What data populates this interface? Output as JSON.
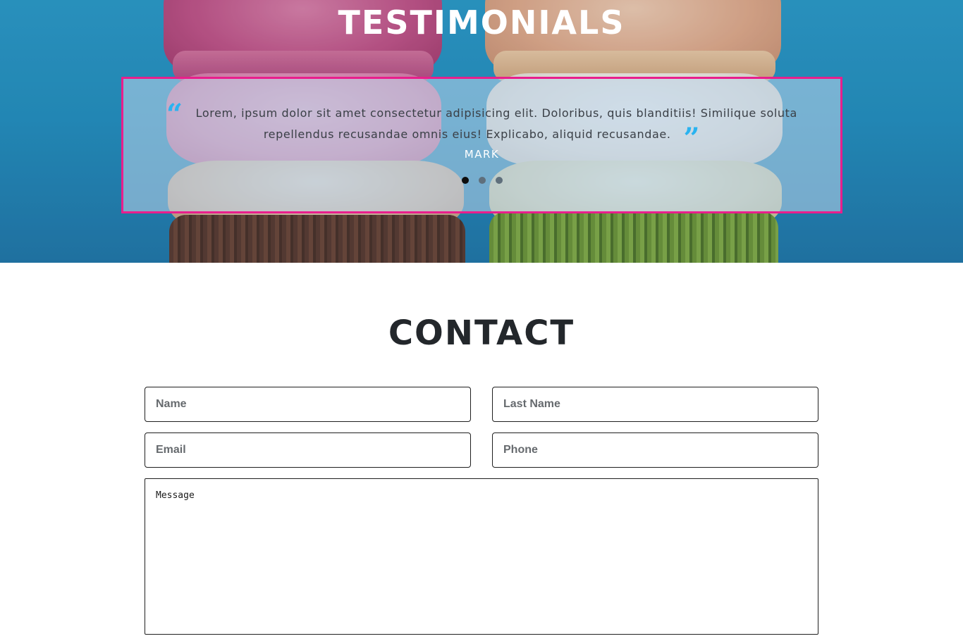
{
  "testimonials": {
    "title": "TESTIMONIALS",
    "quote_text": "Lorem, ipsum dolor sit amet consectetur adipisicing elit. Doloribus, quis blanditiis! Similique soluta repellendus recusandae omnis eius! Explicabo, aliquid recusandae.",
    "author": "MARK",
    "quote_open_icon": "quote-open-icon",
    "quote_close_icon": "quote-close-icon",
    "slides": [
      {
        "active": true
      },
      {
        "active": false
      },
      {
        "active": false
      }
    ],
    "colors": {
      "border": "#e91e8c",
      "quote_icon": "#2ab3f0",
      "title": "#ffffff"
    }
  },
  "contact": {
    "title": "CONTACT",
    "fields": {
      "name_placeholder": "Name",
      "lastname_placeholder": "Last Name",
      "email_placeholder": "Email",
      "phone_placeholder": "Phone",
      "message_placeholder": "Message"
    }
  }
}
